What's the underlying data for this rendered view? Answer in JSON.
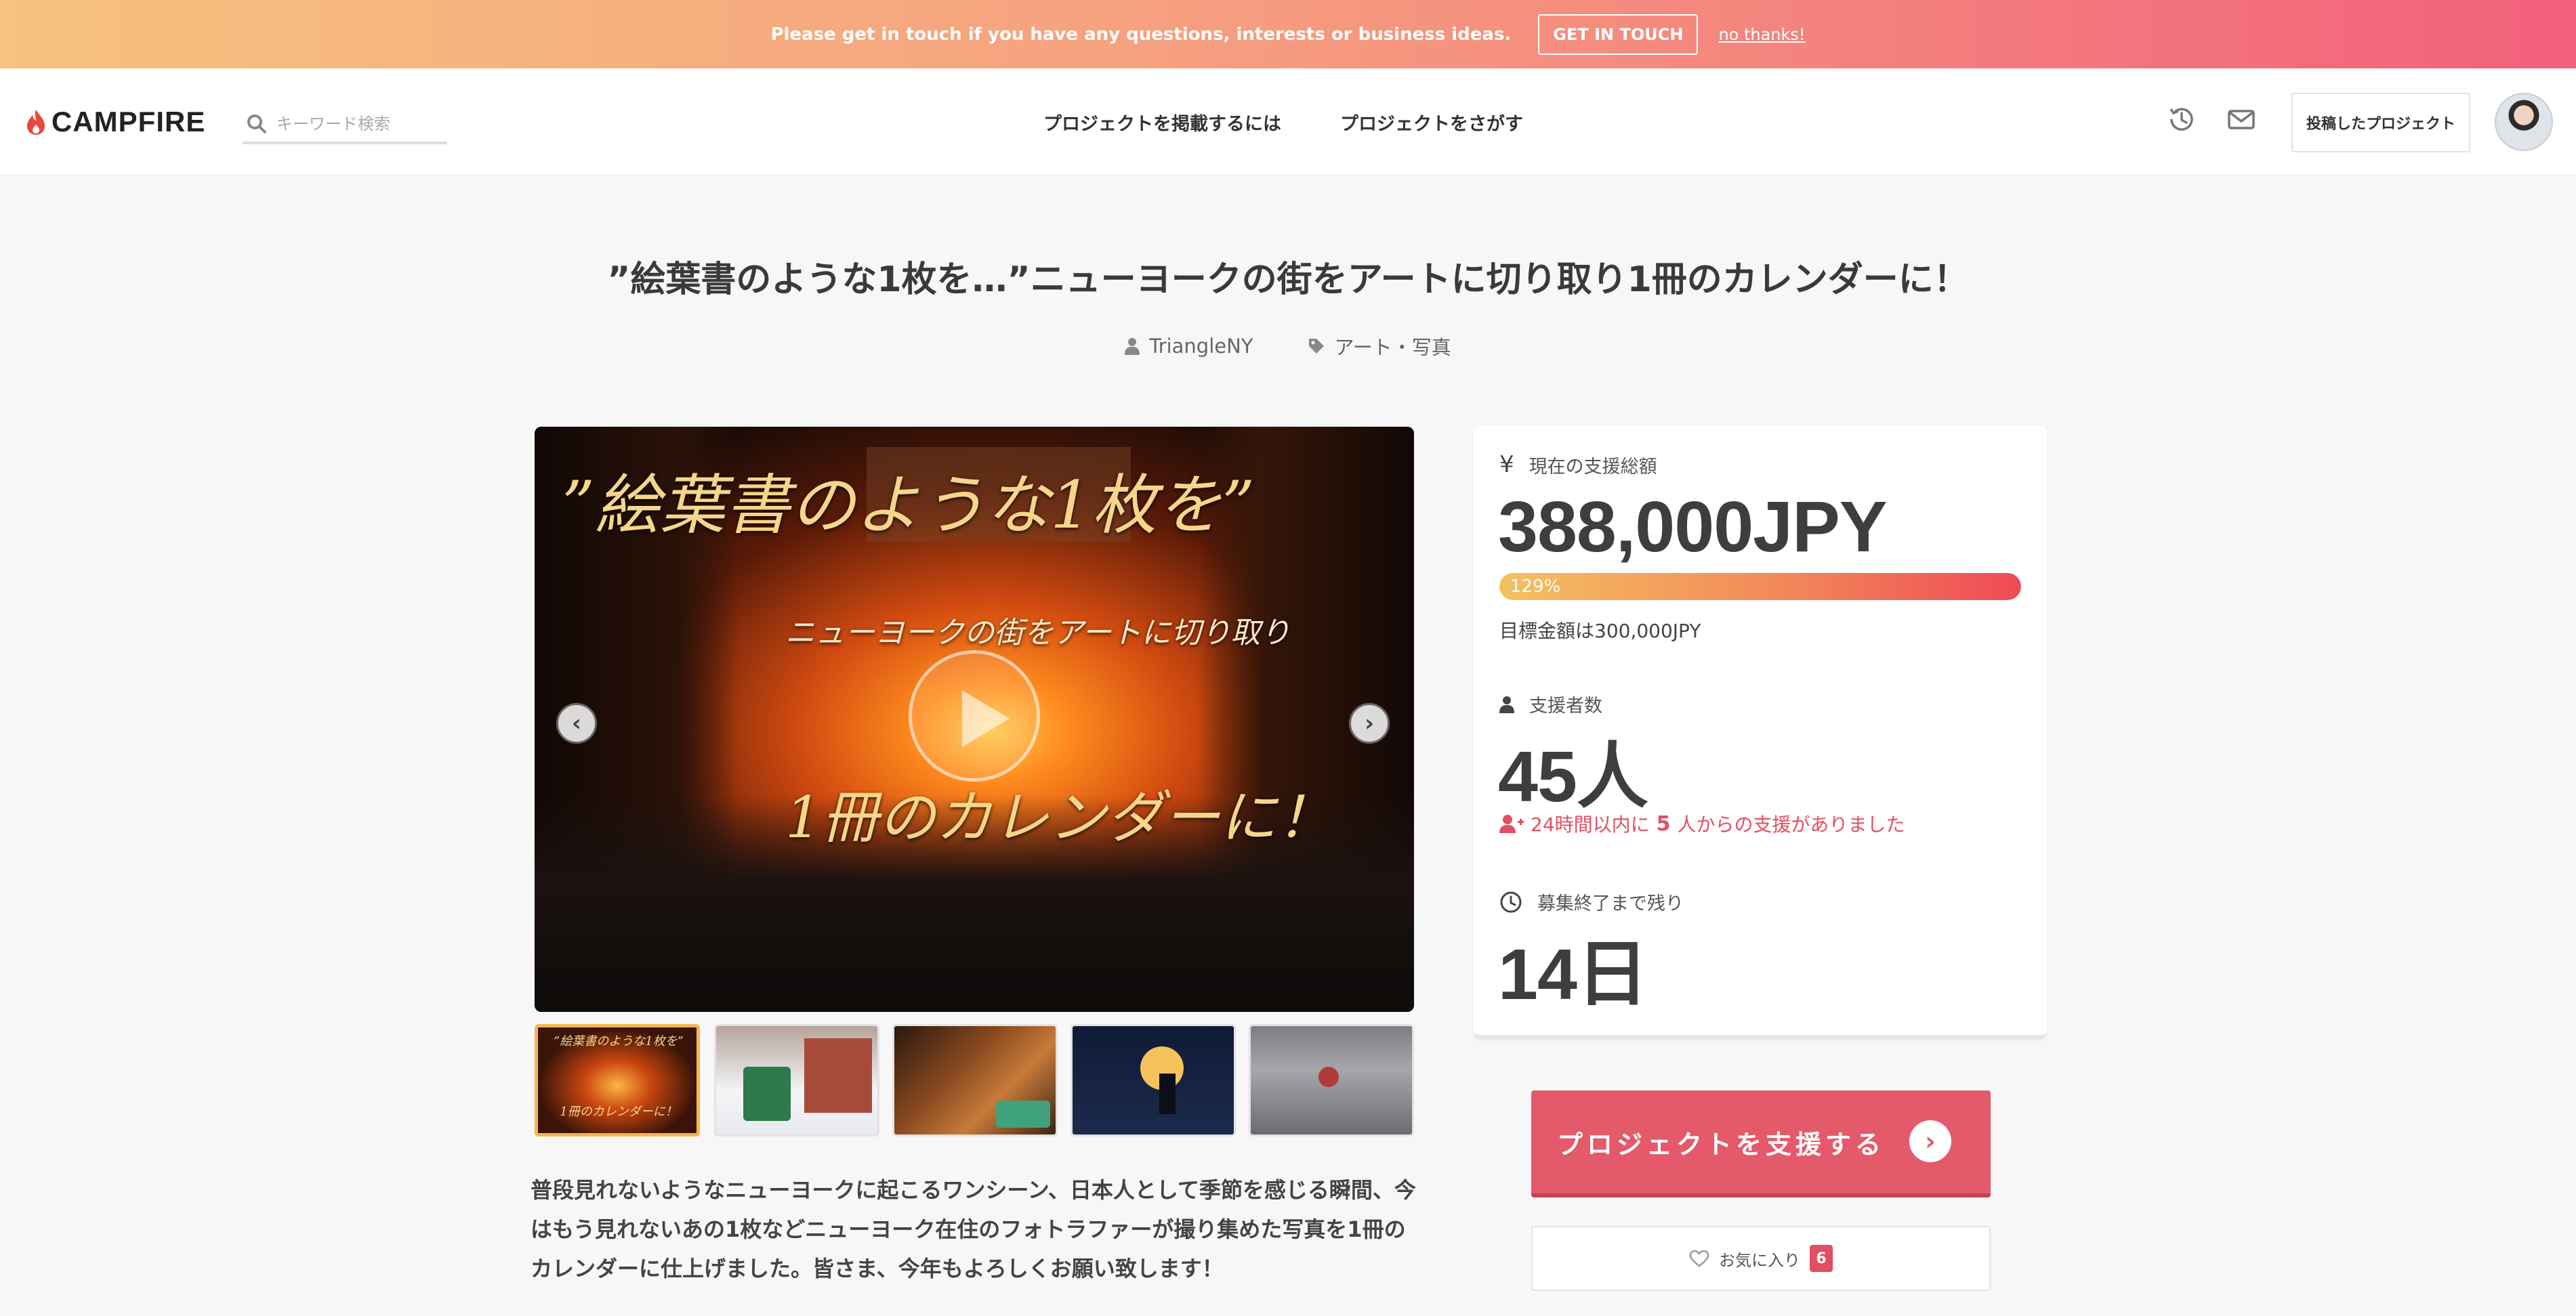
{
  "banner": {
    "message": "Please get in touch if you have any questions, interests or business ideas.",
    "cta_label": "GET IN TOUCH",
    "dismiss_label": "no thanks!"
  },
  "header": {
    "logo_text": "CAMPFIRE",
    "search_placeholder": "キーワード検索",
    "nav": [
      {
        "label": "プロジェクトを掲載するには"
      },
      {
        "label": "プロジェクトをさがす"
      }
    ],
    "posted_projects_label": "投稿したプロジェクト",
    "icons": [
      "history-icon",
      "mail-icon"
    ]
  },
  "project": {
    "title": "”絵葉書のような1枚を…”ニューヨークの街をアートに切り取り1冊のカレンダーに！",
    "owner": "TriangleNY",
    "category": "アート・写真",
    "media_text": {
      "line1": "”絵葉書のような1枚を”",
      "line2": "ニューヨークの街をアートに切り取り",
      "line3": "1冊のカレンダーに！"
    },
    "description": "普段見れないようなニューヨークに起こるワンシーン、日本人として季節を感じる瞬間、今はもう見れないあの1枚などニューヨーク在住のフォトラファーが撮り集めた写真を1冊のカレンダーに仕上げました。皆さま、今年もよろしくお願い致します！",
    "thumbnails": [
      {
        "text": "”絵葉書のような1枚を”",
        "subtext": "1冊のカレンダーに！",
        "active": true
      },
      {
        "active": false
      },
      {
        "active": false
      },
      {
        "active": false
      },
      {
        "active": false
      }
    ]
  },
  "stats": {
    "total_label": "現在の支援総額",
    "total_value": "388,000JPY",
    "progress_percent": 129,
    "progress_label": "129%",
    "goal_text": "目標金額は300,000JPY",
    "supporters_label": "支援者数",
    "supporters_value": "45人",
    "recent_prefix": "24時間以内に",
    "recent_count": "5",
    "recent_suffix": "人からの支援がありました",
    "remaining_label": "募集終了まで残り",
    "remaining_value": "14日"
  },
  "actions": {
    "support_label": "プロジェクトを支援する",
    "favorite_label": "お気に入り",
    "favorite_count": "6"
  },
  "colors": {
    "accent": "#e45a6b",
    "progress_start": "#f4c160",
    "progress_end": "#ef4a57",
    "banner_start": "#f6c27e",
    "banner_end": "#f2607c",
    "thumb_active_border": "#f3b84c"
  }
}
